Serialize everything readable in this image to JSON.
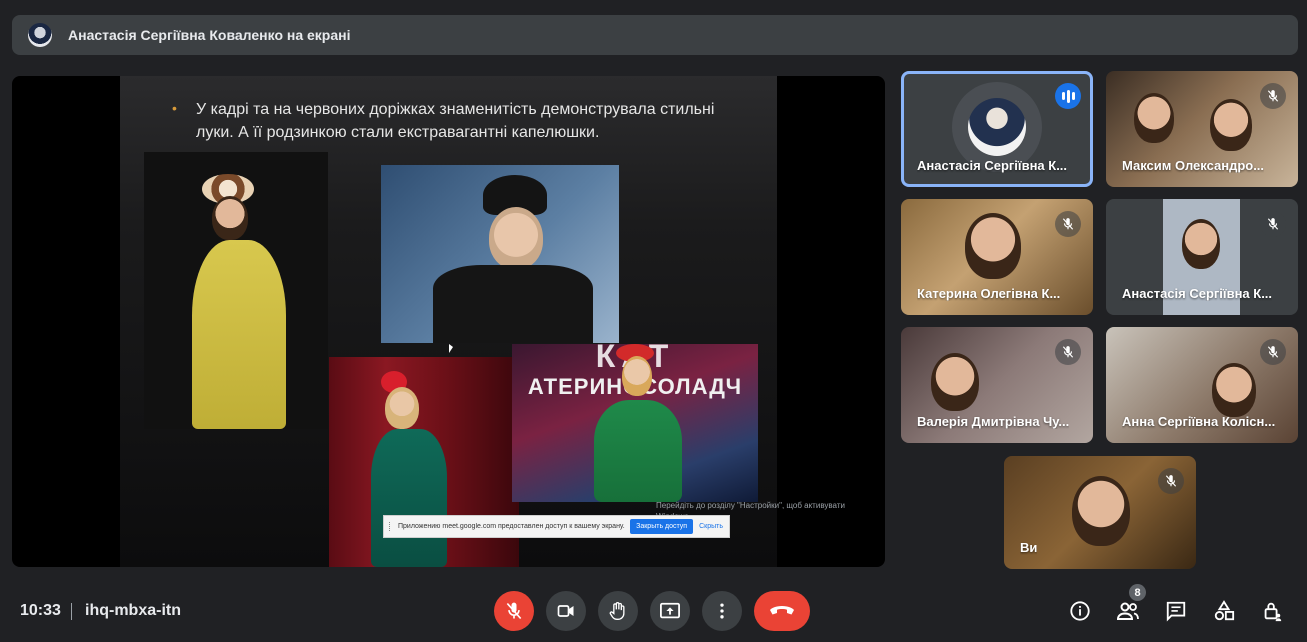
{
  "banner": {
    "title": "Анастасія Сергіївна Коваленко на екрані"
  },
  "slide": {
    "bullet": "У кадрі та на червоних доріжках знаменитість демонструвала стильні луки. А її родзинкою стали екстравагантні капелюшки.",
    "photo4_banner_top": "КАТ",
    "photo4_banner": "АТЕРИНОСОЛАДЧ",
    "activate_windows": "Перейдіть до розділу \"Настройки\", щоб активувати Windows.",
    "share_notice": "Приложению meet.google.com предоставлен доступ к вашему экрану.",
    "share_stop": "Закрыть доступ",
    "share_hide": "Скрыть"
  },
  "participants": [
    {
      "name": "Анастасія Сергіївна К..."
    },
    {
      "name": "Максим Олександро..."
    },
    {
      "name": "Катерина Олегівна К..."
    },
    {
      "name": "Анастасія Сергіївна К..."
    },
    {
      "name": "Валерія Дмитрівна Чу..."
    },
    {
      "name": "Анна Сергіївна Колісн..."
    },
    {
      "name": "Ви"
    }
  ],
  "footer": {
    "time": "10:33",
    "meeting_code": "ihq-mbxa-itn",
    "people_count": "8"
  },
  "colors": {
    "accent": "#8ab4f8",
    "danger": "#ea4335",
    "speaking": "#1a73e8",
    "background": "#202124",
    "surface": "#3c4043"
  }
}
